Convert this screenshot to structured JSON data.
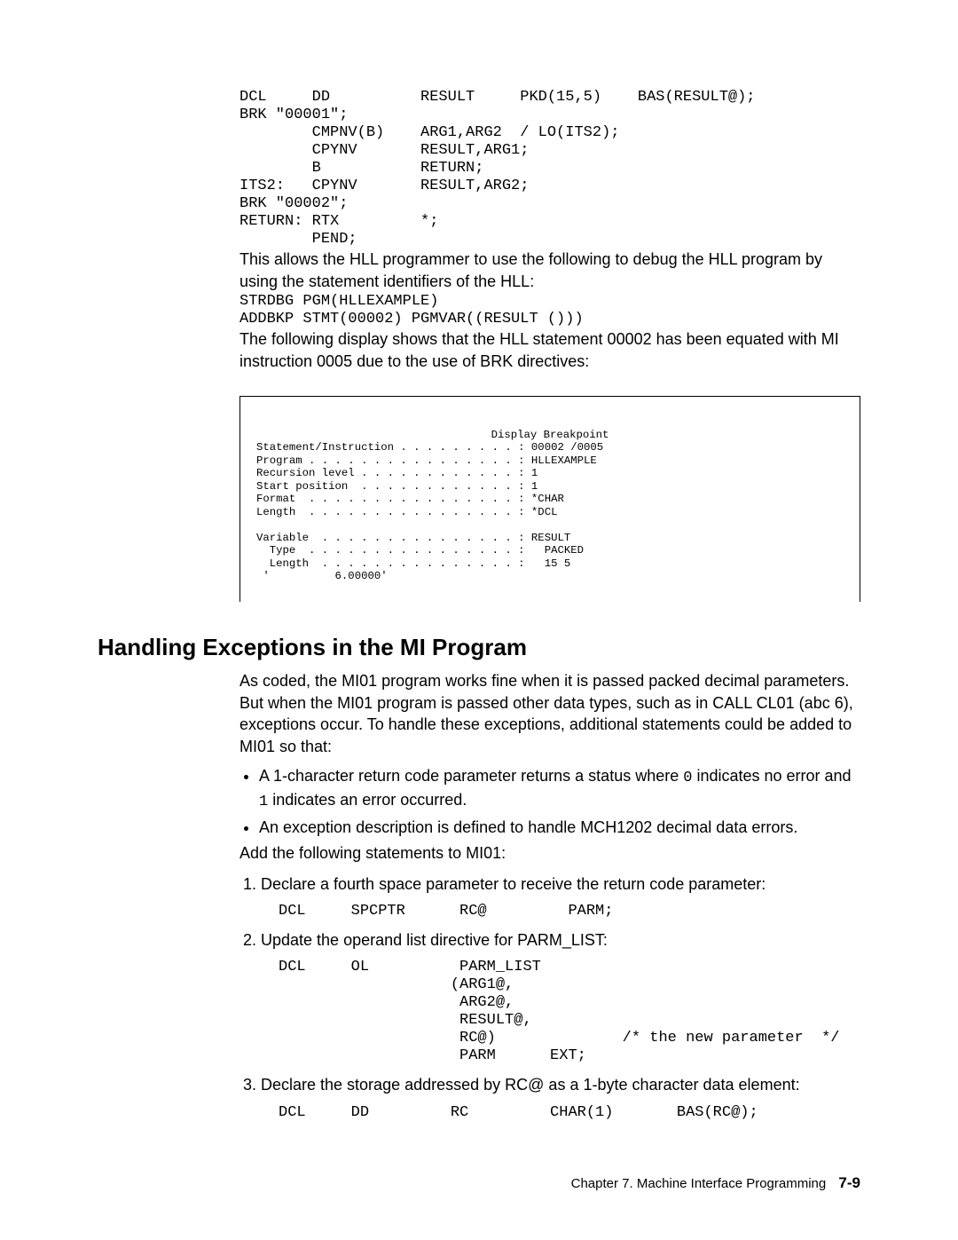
{
  "codeblock1": "DCL     DD          RESULT     PKD(15,5)    BAS(RESULT@);\nBRK \"00001\";\n        CMPNV(B)    ARG1,ARG2  / LO(ITS2);\n        CPYNV       RESULT,ARG1;\n        B           RETURN;\nITS2:   CPYNV       RESULT,ARG2;\nBRK \"00002\";\nRETURN: RTX         *;\n        PEND;",
  "para1": "This allows the HLL programmer to use the following to debug the HLL program by using the statement identifiers of the HLL:",
  "codeblock2": "STRDBG PGM(HLLEXAMPLE)\nADDBKP STMT(00002) PGMVAR((RESULT ()))",
  "para2": "The following display shows that the HLL statement 00002 has been equated with MI instruction 0005 due to the use of BRK directives:",
  "display": {
    "title": "Display Breakpoint",
    "body": "Statement/Instruction . . . . . . . . . : 00002 /0005\nProgram . . . . . . . . . . . . . . . . : HLLEXAMPLE\nRecursion level . . . . . . . . . . . . : 1\nStart position  . . . . . . . . . . . . : 1\nFormat  . . . . . . . . . . . . . . . . : *CHAR\nLength  . . . . . . . . . . . . . . . . : *DCL\n\nVariable  . . . . . . . . . . . . . . . : RESULT\n  Type  . . . . . . . . . . . . . . . . :   PACKED\n  Length  . . . . . . . . . . . . . . . :   15 5\n '          6.00000'"
  },
  "section_heading": "Handling Exceptions in the MI Program",
  "para3_a": "As coded, the MI01 program works fine when it is passed packed decimal parameters.  But when the MI01 program is passed other data types, such as in CALL CL01 (abc   6), exceptions occur.  To handle these exceptions, additional statements could be added to MI01 so that:",
  "bullets": {
    "b1_a": "A 1-character return code parameter returns a status where ",
    "b1_code0": "0",
    "b1_b": " indicates no error and ",
    "b1_code1": "1",
    "b1_c": " indicates an error occurred.",
    "b2": "An exception description is defined to handle MCH1202 decimal data errors."
  },
  "para4": "Add the following statements to MI01:",
  "steps": {
    "s1": {
      "text": "Declare a fourth space parameter to receive the return code parameter:",
      "code": "DCL     SPCPTR      RC@         PARM;"
    },
    "s2": {
      "text": "Update the operand list directive for PARM_LIST:",
      "code": "DCL     OL          PARM_LIST\n                   (ARG1@,\n                    ARG2@,\n                    RESULT@,\n                    RC@)              /* the new parameter  */\n                    PARM      EXT;"
    },
    "s3": {
      "text": "Declare the storage addressed by RC@ as a 1-byte character data element:",
      "code": "DCL     DD         RC         CHAR(1)       BAS(RC@);"
    }
  },
  "footer": {
    "chapter": "Chapter 7.  Machine Interface Programming",
    "page": "7-9"
  }
}
